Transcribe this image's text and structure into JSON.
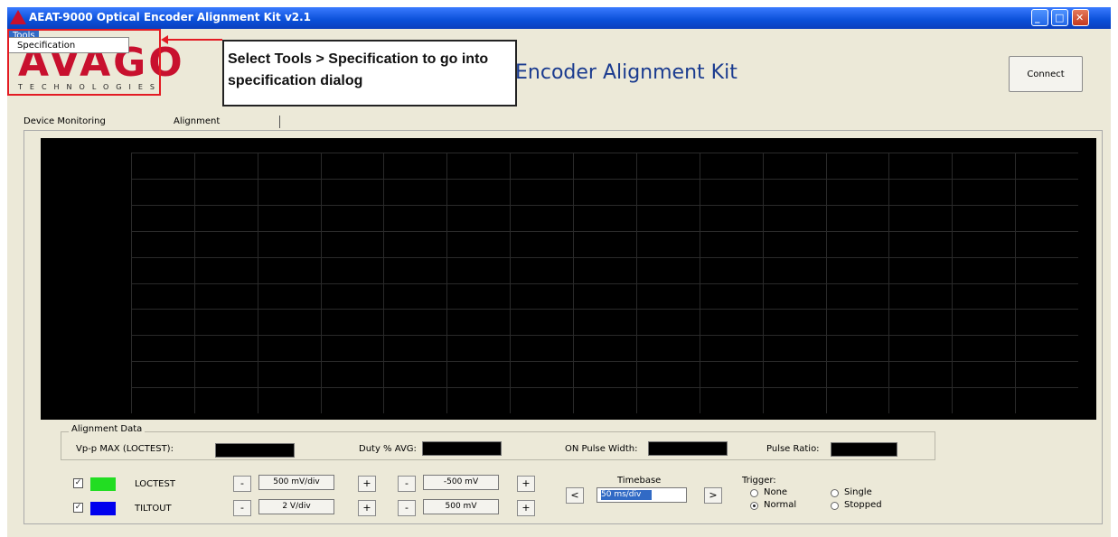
{
  "window": {
    "title": "AEAT-9000 Optical Encoder Alignment Kit v2.1",
    "min_glyph": "_",
    "max_glyph": "□",
    "close_glyph": "✕"
  },
  "menu": {
    "tools_label": "Tools",
    "dropdown_item": "Specification"
  },
  "logo": {
    "word": "AVAGO",
    "sub": "TECHNOLOGIES"
  },
  "header": {
    "heading": "Encoder Alignment Kit",
    "connect_label": "Connect"
  },
  "annotation": {
    "text": "Select Tools > Specification to go into specification dialog",
    "color": "#e31b23"
  },
  "tabs": [
    {
      "label": "Device Monitoring"
    },
    {
      "label": "Alignment"
    }
  ],
  "alignment_data": {
    "title": "Alignment Data",
    "vpp_label": "Vp-p MAX (LOCTEST):",
    "duty_label": "Duty % AVG:",
    "on_pulse_label": "ON Pulse Width:",
    "pulse_ratio_label": "Pulse Ratio:"
  },
  "channels": [
    {
      "name": "LOCTEST",
      "checked": true,
      "check_glyph": "✓",
      "color": "#22dd22",
      "scale": "500 mV/div",
      "offset": "-500 mV"
    },
    {
      "name": "TILTOUT",
      "checked": true,
      "check_glyph": "✓",
      "color": "#0000ee",
      "scale": "2 V/div",
      "offset": "500 mV"
    }
  ],
  "controls": {
    "minus": "-",
    "plus": "+",
    "prev": "<",
    "next": ">"
  },
  "timebase": {
    "label": "Timebase",
    "value": "50 ms/div"
  },
  "trigger": {
    "label": "Trigger:",
    "options": [
      "None",
      "Single",
      "Normal",
      "Stopped"
    ],
    "selected": "Normal"
  }
}
